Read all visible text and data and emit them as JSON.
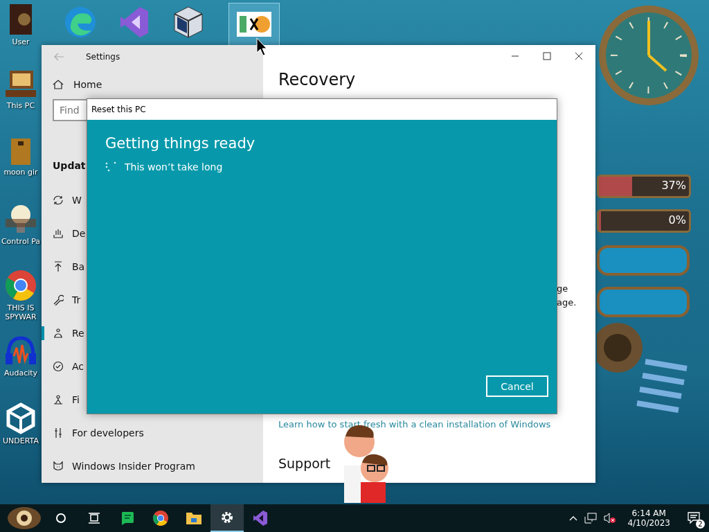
{
  "desktop": {
    "top_icons": [
      {
        "kind": "edge",
        "selected": false
      },
      {
        "kind": "studio",
        "selected": false
      },
      {
        "kind": "cube",
        "selected": false
      },
      {
        "kind": "hex",
        "selected": true
      }
    ],
    "left_icons": [
      {
        "kind": "folder-dark",
        "label": "User"
      },
      {
        "kind": "computer",
        "label": "This PC"
      },
      {
        "kind": "bin",
        "label": "moon gir"
      },
      {
        "kind": "bulb",
        "label": "Control Pa"
      },
      {
        "kind": "chrome",
        "label": "THIS IS SPYWAR"
      },
      {
        "kind": "headphones",
        "label": "Audacity"
      },
      {
        "kind": "unity",
        "label": "UNDERTA"
      }
    ],
    "gauges": [
      {
        "reading": "37%",
        "level": 0.37
      },
      {
        "reading": "0%",
        "level": 0
      }
    ]
  },
  "settings_window": {
    "title": "Settings",
    "sidebar": {
      "home": "Home",
      "search": {
        "placeholder": "Find"
      },
      "heading": "Updat",
      "items": [
        {
          "kind": "sync",
          "label": "W",
          "selected": false
        },
        {
          "kind": "delivery",
          "label": "De",
          "selected": false
        },
        {
          "kind": "backup",
          "label": "Ba",
          "selected": false
        },
        {
          "kind": "wrench",
          "label": "Tr",
          "selected": false
        },
        {
          "kind": "recovery",
          "label": "Re",
          "selected": true
        },
        {
          "kind": "check",
          "label": "Ac",
          "selected": false
        },
        {
          "kind": "find",
          "label": "Fi",
          "selected": false
        },
        {
          "kind": "dev",
          "label": "For developers",
          "selected": false
        },
        {
          "kind": "cat",
          "label": "Windows Insider Program",
          "selected": false
        }
      ]
    },
    "content": {
      "heading": "Recovery",
      "fragments": [
        "ge",
        "age."
      ],
      "link": "Learn how to start fresh with a clean installation of Windows",
      "support_heading": "Support"
    }
  },
  "dialog": {
    "title": "Reset this PC",
    "heading": "Getting things ready",
    "status": "This won’t take long",
    "button": "Cancel"
  },
  "taskbar": {
    "apps": [
      {
        "kind": "search-circle",
        "active": false
      },
      {
        "kind": "task-view",
        "active": false
      },
      {
        "kind": "chat",
        "active": false
      },
      {
        "kind": "chrome",
        "active": false
      },
      {
        "kind": "explorer",
        "active": false
      },
      {
        "kind": "settings",
        "active": true
      },
      {
        "kind": "studio",
        "active": false
      }
    ],
    "time": "6:14 AM",
    "date": "4/10/2023",
    "notifications": "2"
  }
}
